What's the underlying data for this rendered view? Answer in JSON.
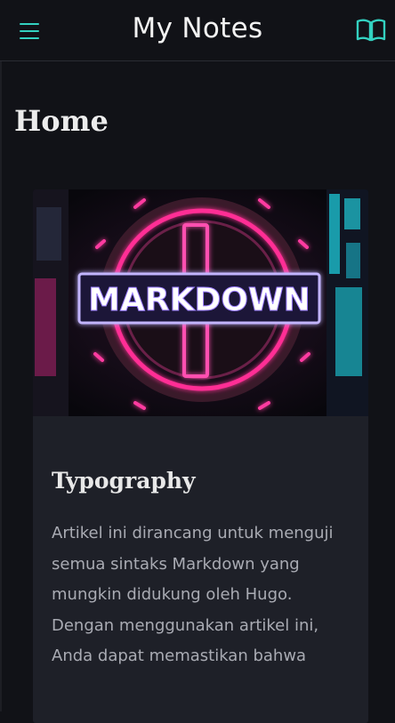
{
  "header": {
    "title": "My Notes",
    "menu_icon": "hamburger-menu-icon",
    "book_icon": "open-book-icon",
    "accent_color": "#33d1c0"
  },
  "page": {
    "title": "Home"
  },
  "posts": [
    {
      "image_text": "MARKDOWN",
      "title": "Typography",
      "excerpt": "Artikel ini dirancang untuk menguji semua sintaks Markdown yang mungkin didukung oleh Hugo. Dengan menggunakan artikel ini, Anda dapat memastikan bahwa"
    }
  ]
}
